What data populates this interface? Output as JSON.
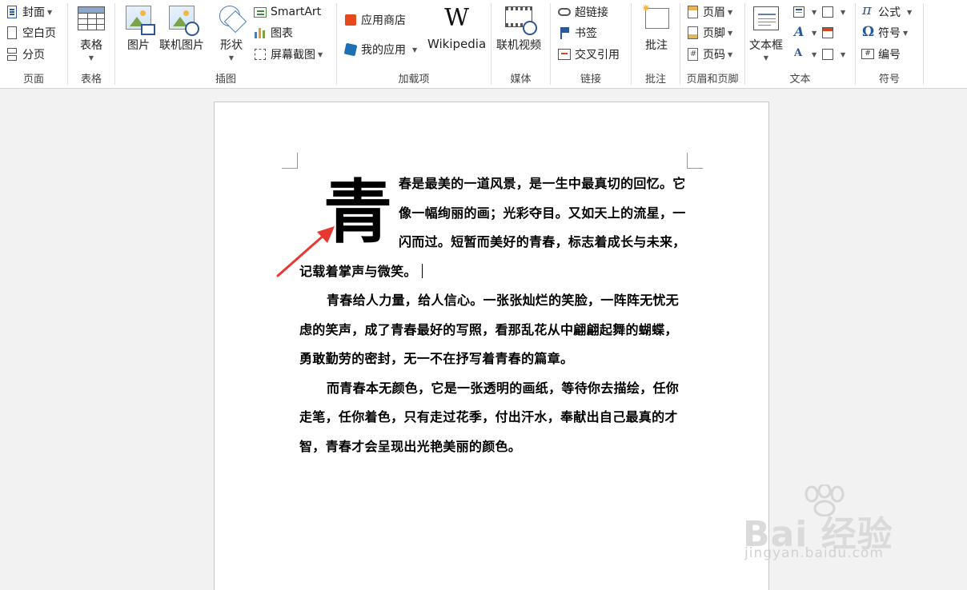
{
  "ribbon": {
    "groups": {
      "pages": {
        "label": "页面",
        "items": [
          "封面",
          "空白页",
          "分页"
        ]
      },
      "tables": {
        "label": "表格",
        "button": "表格"
      },
      "illustrations": {
        "label": "插图",
        "picture": "图片",
        "online_picture": "联机图片",
        "shapes": "形状",
        "smartart": "SmartArt",
        "chart": "图表",
        "screenshot": "屏幕截图"
      },
      "addins": {
        "label": "加载项",
        "store": "应用商店",
        "my_apps": "我的应用",
        "wikipedia": "Wikipedia",
        "wiki_glyph": "W"
      },
      "media": {
        "label": "媒体",
        "online_video": "联机视频"
      },
      "links": {
        "label": "链接",
        "hyperlink": "超链接",
        "bookmark": "书签",
        "cross_reference": "交叉引用"
      },
      "comments": {
        "label": "批注",
        "comment": "批注"
      },
      "header_footer": {
        "label": "页眉和页脚",
        "header": "页眉",
        "footer": "页脚",
        "page_number": "页码"
      },
      "text": {
        "label": "文本",
        "textbox": "文本框"
      },
      "symbols": {
        "label": "符号",
        "equation": "公式",
        "symbol": "符号",
        "numbering": "编号",
        "pi_glyph": "π",
        "omega_glyph": "Ω",
        "hash_glyph": "#"
      }
    }
  },
  "document": {
    "dropcap": "青",
    "paragraph1": "春是最美的一道风景，是一生中最真切的回忆。它像一幅绚丽的画；光彩夺目。又如天上的流星，一闪而过。短暂而美好的青春，标志着成长与未来，记载着掌声与微笑。",
    "paragraph2": "青春给人力量，给人信心。一张张灿烂的笑脸，一阵阵无忧无虑的笑声，成了青春最好的写照，看那乱花从中翩翩起舞的蝴蝶，勇敢勤劳的密封，无一不在抒写着青春的篇章。",
    "paragraph3": "而青春本无颜色，它是一张透明的画纸，等待你去描绘，任你走笔，任你着色，只有走过花季，付出汗水，奉献出自己最真的才智，青春才会呈现出光艳美丽的颜色。"
  },
  "watermark": {
    "main": "Bai 经验",
    "sub": "jingyan.baidu.com"
  },
  "colors": {
    "accent": "#2b5797",
    "arrow": "#e8382f",
    "ribbon_bg": "#ffffff",
    "workspace_bg": "#f2f2f2"
  }
}
